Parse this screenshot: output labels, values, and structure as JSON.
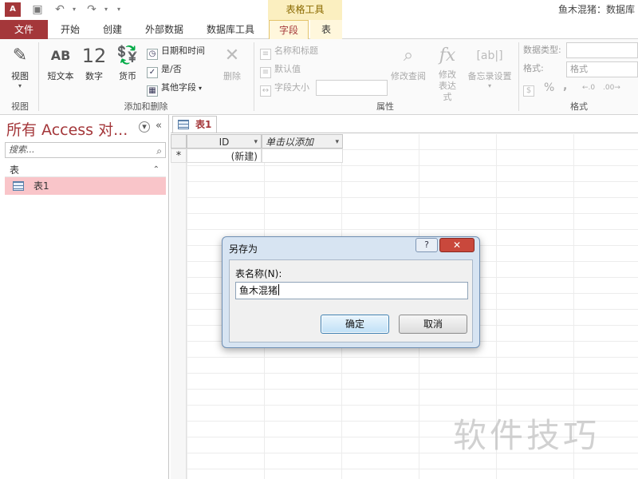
{
  "titlebar": {
    "app_icon": "A",
    "undo_icon": "↶",
    "redo_icon": "↷",
    "context_group": "表格工具",
    "window_title": "鱼木混猪：数据库"
  },
  "tabs": {
    "file": "文件",
    "home": "开始",
    "create": "创建",
    "external": "外部数据",
    "dbtools": "数据库工具",
    "fields": "字段",
    "table": "表"
  },
  "ribbon": {
    "view": {
      "label": "视图",
      "group": "视图"
    },
    "add_delete": {
      "short_text": "短文本",
      "short_text_glyph": "AB",
      "number": "数字",
      "number_glyph": "12",
      "currency": "货币",
      "datetime": "日期和时间",
      "yesno": "是/否",
      "more_fields": "其他字段",
      "delete": "删除",
      "group": "添加和删除"
    },
    "properties": {
      "name_caption": "名称和标题",
      "default_value": "默认值",
      "field_size": "字段大小",
      "modify_lookup": "修改查阅",
      "modify_expression": "修改表达式",
      "memo_settings": "备忘录设置",
      "group": "属性"
    },
    "formatting": {
      "data_type_label": "数据类型:",
      "format_label": "格式:",
      "format_value": "格式",
      "percent": "%",
      "comma": ",",
      "group": "格式"
    }
  },
  "navpane": {
    "title": "所有 Access 对...",
    "search_placeholder": "搜索...",
    "group": "表",
    "item": "表1"
  },
  "document": {
    "tab": "表1",
    "columns": [
      "ID",
      "单击以添加"
    ],
    "new_row_marker": "*",
    "new_row_value": "(新建)"
  },
  "dialog": {
    "title": "另存为",
    "help": "?",
    "close": "✕",
    "field_label": "表名称(N):",
    "field_value": "鱼木混猪",
    "ok": "确定",
    "cancel": "取消"
  },
  "watermark": "软件技巧"
}
